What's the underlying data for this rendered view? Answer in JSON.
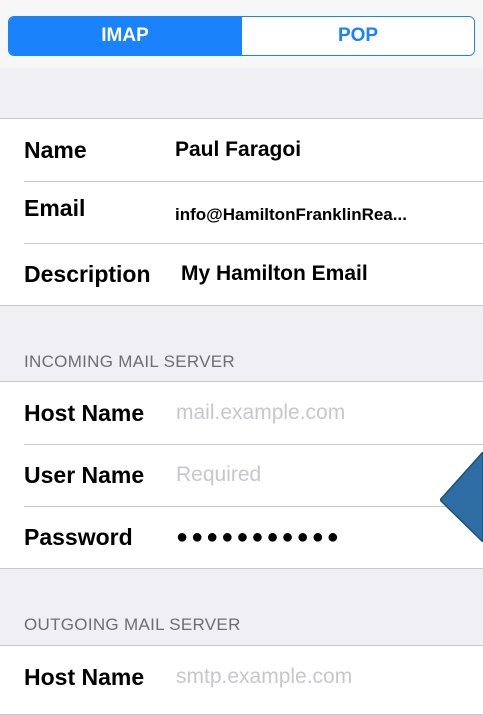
{
  "segmented": {
    "options": [
      "IMAP",
      "POP"
    ],
    "selected": "IMAP"
  },
  "account": {
    "name_label": "Name",
    "name_value": "Paul Faragoi",
    "email_label": "Email",
    "email_value": "info@HamiltonFranklinRea...",
    "description_label": "Description",
    "description_value": "My Hamilton Email"
  },
  "incoming": {
    "header": "INCOMING MAIL SERVER",
    "host_label": "Host Name",
    "host_placeholder": "mail.example.com",
    "user_label": "User Name",
    "user_placeholder": "Required",
    "password_label": "Password",
    "password_value": "●●●●●●●●●●●"
  },
  "outgoing": {
    "header": "OUTGOING MAIL SERVER",
    "host_label": "Host Name",
    "host_placeholder": "smtp.example.com"
  },
  "colors": {
    "accent": "#1a82fb",
    "background": "#efeff4",
    "arrow": "#2e6da4"
  }
}
